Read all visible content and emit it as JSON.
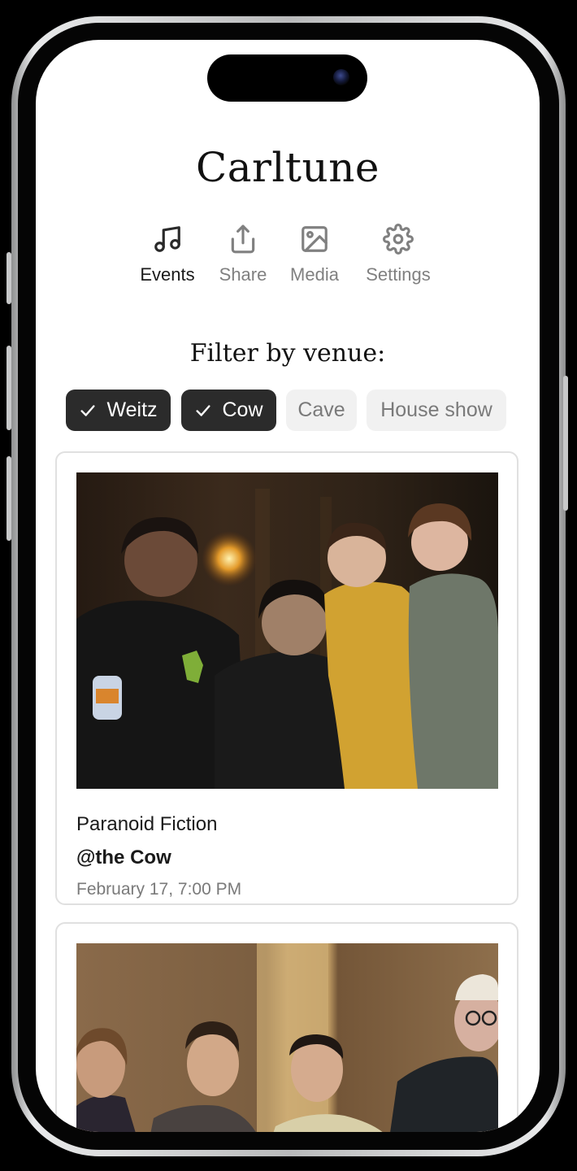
{
  "app": {
    "title": "Carltune"
  },
  "nav": [
    {
      "label": "Events",
      "icon": "music-note-icon",
      "active": true
    },
    {
      "label": "Share",
      "icon": "share-icon",
      "active": false
    },
    {
      "label": "Media",
      "icon": "image-icon",
      "active": false
    },
    {
      "label": "Settings",
      "icon": "gear-icon",
      "active": false
    }
  ],
  "filter": {
    "title": "Filter by venue:",
    "chips": [
      {
        "label": "Weitz",
        "selected": true
      },
      {
        "label": "Cow",
        "selected": true
      },
      {
        "label": "Cave",
        "selected": false
      },
      {
        "label": "House show",
        "selected": false
      }
    ]
  },
  "events": [
    {
      "band": "Paranoid Fiction",
      "venue": "@the Cow",
      "datetime": "February 17, 7:00 PM",
      "photo": "band-photo"
    },
    {
      "band": "",
      "venue": "",
      "datetime": "",
      "photo": "band-photo"
    }
  ],
  "colors": {
    "chip_selected_bg": "#2b2b2b",
    "chip_unselected_bg": "#f1f1f1",
    "nav_inactive": "#808080",
    "card_border": "#e0e0e0"
  }
}
